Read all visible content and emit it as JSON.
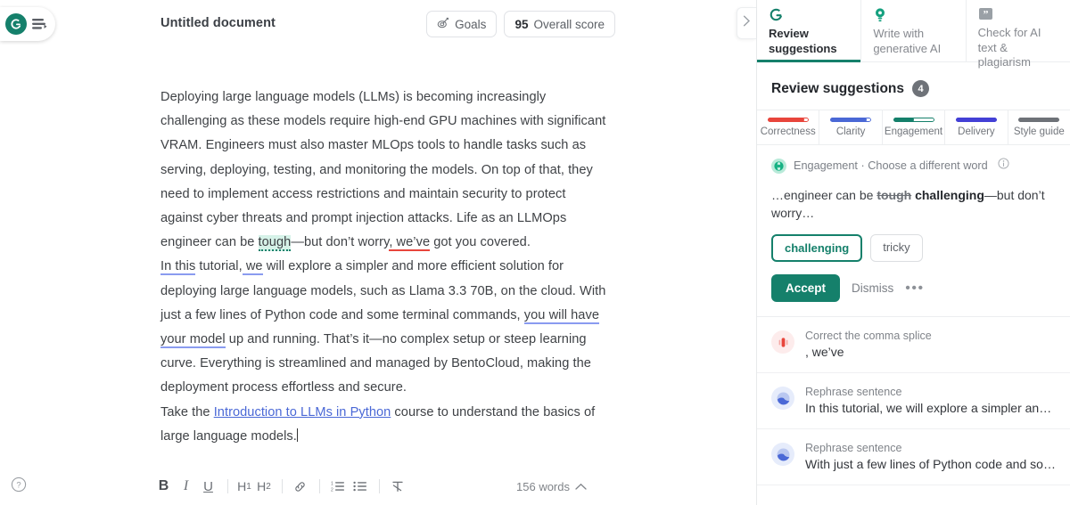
{
  "app": {
    "logo_name": "grammarly-logo",
    "doc_title": "Untitled document"
  },
  "toolbar": {
    "goals_label": "Goals",
    "score_value": "95",
    "score_label": "Overall score"
  },
  "document": {
    "paragraphs": [
      {
        "id": "p1",
        "runs": [
          {
            "text": "Deploying large language models (LLMs) is becoming increasingly challenging as these models require high-end GPU machines with significant VRAM. Engineers must also master MLOps tools to handle tasks such as serving, deploying, testing, and monitoring the models. On top of that, they need to implement access restrictions and maintain security to protect against cyber threats and prompt injection attacks. Life as an LLMOps engineer can be ",
            "style": "plain"
          },
          {
            "text": "tough",
            "style": "engagement-highlight"
          },
          {
            "text": "—but don’t worry",
            "style": "plain"
          },
          {
            "text": ", we’ve",
            "style": "correctness-underline"
          },
          {
            "text": " got you covered.",
            "style": "plain"
          }
        ]
      },
      {
        "id": "p2",
        "runs": [
          {
            "text": "In this",
            "style": "clarity-underline"
          },
          {
            "text": " tutorial,",
            "style": "plain"
          },
          {
            "text": " we",
            "style": "clarity-underline"
          },
          {
            "text": " will explore a simpler and more efficient solution for deploying large language models, such as Llama 3.3 70B, on the cloud. With just a few lines of Python code and some terminal commands, ",
            "style": "plain"
          },
          {
            "text": "you will have your model",
            "style": "clarity-underline"
          },
          {
            "text": " up and running. That’s it—no complex setup or steep learning curve. Everything is streamlined and managed by BentoCloud, making the deployment process effortless and secure.",
            "style": "plain"
          }
        ]
      },
      {
        "id": "p3",
        "runs": [
          {
            "text": "Take the ",
            "style": "plain"
          },
          {
            "text": "Introduction to LLMs in Python",
            "style": "link"
          },
          {
            "text": " course to understand the basics of large language models.",
            "style": "plain"
          }
        ]
      }
    ]
  },
  "format_toolbar": {
    "items": [
      {
        "name": "bold-button",
        "label": "B"
      },
      {
        "name": "italic-button",
        "label": "I"
      },
      {
        "name": "underline-button",
        "label": "U"
      },
      {
        "name": "heading-1-button",
        "label": "H1"
      },
      {
        "name": "heading-2-button",
        "label": "H2"
      },
      {
        "name": "link-button",
        "label": "🔗"
      },
      {
        "name": "numbered-list-button",
        "label": "1."
      },
      {
        "name": "bullet-list-button",
        "label": "•"
      },
      {
        "name": "clear-formatting-button",
        "label": "T"
      }
    ],
    "word_count": "156 words"
  },
  "help": {
    "label": "?"
  },
  "sidebar": {
    "tabs": [
      {
        "name": "tab-review-suggestions",
        "label": "Review suggestions",
        "icon": "grammarly-g-icon",
        "active": true
      },
      {
        "name": "tab-write-with-generative-ai",
        "label": "Write with generative AI",
        "icon": "lightbulb-icon",
        "active": false
      },
      {
        "name": "tab-check-for-ai-text-plagiarism",
        "label": "Check for AI text & plagiarism",
        "icon": "quote-icon",
        "active": false
      }
    ],
    "panel_title": "Review suggestions",
    "panel_count": "4",
    "categories": [
      {
        "name": "category-correctness",
        "label": "Correctness",
        "color": "#e8453c",
        "fill": 90
      },
      {
        "name": "category-clarity",
        "label": "Clarity",
        "color": "#4a68d6",
        "fill": 88
      },
      {
        "name": "category-engagement",
        "label": "Engagement",
        "color": "#15806b",
        "fill": 52
      },
      {
        "name": "category-delivery",
        "label": "Delivery",
        "color": "#4340d6",
        "fill": 100
      },
      {
        "name": "category-style-guide",
        "label": "Style guide",
        "color": "#6e7278",
        "fill": 100
      }
    ],
    "active_suggestion": {
      "category": "Engagement · Choose a different word",
      "preview_before": "…engineer can be ",
      "preview_strike": "tough",
      "preview_new": "challenging",
      "preview_after": "—but don’t worry…",
      "chips": [
        {
          "label": "challenging",
          "selected": true
        },
        {
          "label": "tricky",
          "selected": false
        }
      ],
      "accept_label": "Accept",
      "dismiss_label": "Dismiss",
      "more_label": "•••"
    },
    "suggestions": [
      {
        "name": "suggestion-comma-splice",
        "type": "correctness",
        "title": "Correct the comma splice",
        "snippet": ", we’ve"
      },
      {
        "name": "suggestion-rephrase-1",
        "type": "clarity",
        "title": "Rephrase sentence",
        "snippet": "In this tutorial, we will explore a simpler and more…"
      },
      {
        "name": "suggestion-rephrase-2",
        "type": "clarity",
        "title": "Rephrase sentence",
        "snippet": "With just a few lines of Python code and some…"
      }
    ]
  }
}
